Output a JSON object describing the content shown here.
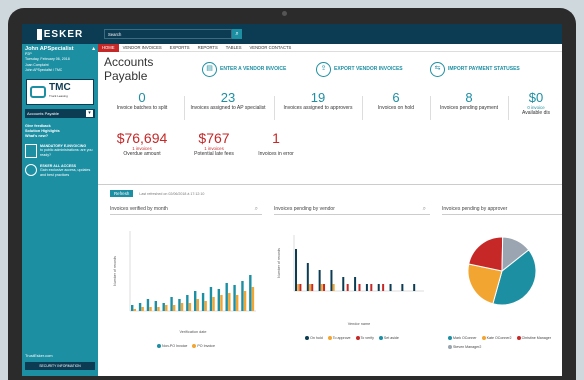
{
  "sidebar": {
    "logo": "ESKER",
    "user_name": "John APSpecialist",
    "user_lines": [
      "P2P",
      "Tuesday, February 06, 2018"
    ],
    "user_sub": [
      "Joan Complaint",
      "John APSpecialist / TMC"
    ],
    "company_short": "TMC",
    "company_sub": "Truck Leasing",
    "select_value": "Accounts Payable",
    "links": [
      "Give feedback",
      "Solution Highlights",
      "What's new?"
    ],
    "promo1_title": "MANDATORY E-INVOICING",
    "promo1_body": "to public administrations: are you ready?",
    "promo2_title": "ESKER ALL ACCESS",
    "promo2_body": "Gain exclusive access, updates and best practices",
    "footer_link": "TrustEsker.com",
    "security_button": "SECURITY INFORMATION"
  },
  "top": {
    "search_value": "Search",
    "nav": [
      "HOME",
      "VENDOR INVOICES",
      "EXPORTS",
      "REPORTS",
      "TABLES",
      "VENDOR CONTACTS"
    ]
  },
  "header": {
    "title": "Accounts Payable",
    "actions": [
      "ENTER A VENDOR INVOICE",
      "EXPORT VENDOR INVOICES",
      "IMPORT PAYMENT STATUSES"
    ]
  },
  "kpis": [
    {
      "value": "0",
      "label": "Invoice batches to split"
    },
    {
      "value": "23",
      "label": "Invoices assigned to AP specialist"
    },
    {
      "value": "19",
      "label": "Invoices assigned to approvers"
    },
    {
      "value": "6",
      "label": "Invoices on hold"
    },
    {
      "value": "8",
      "label": "Invoices pending payment"
    },
    {
      "value": "$0",
      "sub": "0 invoice",
      "label": "Available dis"
    }
  ],
  "kpis2": [
    {
      "value": "$76,694",
      "sub": "1 invoices",
      "label": "Overdue amount"
    },
    {
      "value": "$767",
      "sub": "1 invoices",
      "label": "Potential late fees"
    },
    {
      "value": "1",
      "label": "Invoices in error"
    }
  ],
  "refresh": {
    "button": "Refresh",
    "text": "Last refreshed on 02/06/2018 à 17:12:10"
  },
  "panels": {
    "p1_title": "Invoices verified by month",
    "p2_title": "Invoices pending by vendor",
    "p3_title": "Invoices pending by approver",
    "p1_xlabel": "Verification date",
    "p1_ylabel": "Number of records",
    "p2_xlabel": "Vendor name",
    "p2_ylabel": "Number of records",
    "p1_legend": [
      "Non-PO Invoice",
      "PO Invoice"
    ],
    "p2_legend": [
      "On hold",
      "To approve",
      "To verify",
      "Set aside"
    ],
    "p3_legend": [
      "Mark OConner",
      "Kate OConner2",
      "Christine Manager",
      "Steven Manager2"
    ]
  },
  "colors": {
    "teal": "#1d8fa3",
    "navy": "#0c3c54",
    "red": "#c62828",
    "amber": "#f2a531",
    "grey": "#9aa5b1"
  },
  "chart_data": [
    {
      "type": "bar",
      "title": "Invoices verified by month",
      "xlabel": "Verification date",
      "ylabel": "Number of records",
      "ylim": [
        0,
        40
      ],
      "series": [
        {
          "name": "Non-PO Invoice",
          "values": [
            3,
            4,
            6,
            5,
            4,
            7,
            6,
            8,
            10,
            9,
            12,
            11,
            14,
            13,
            15,
            18
          ]
        },
        {
          "name": "PO Invoice",
          "values": [
            1,
            2,
            2,
            2,
            3,
            3,
            4,
            4,
            6,
            5,
            7,
            8,
            9,
            8,
            10,
            12
          ]
        }
      ]
    },
    {
      "type": "bar",
      "title": "Invoices pending by vendor",
      "xlabel": "Vendor name",
      "ylabel": "Number of records",
      "series": [
        {
          "name": "On hold",
          "values": [
            6,
            4,
            3,
            3,
            2,
            2,
            1,
            1,
            1,
            1,
            1
          ]
        },
        {
          "name": "To approve",
          "values": [
            1,
            1,
            1,
            1,
            0,
            0,
            0,
            0,
            0,
            0,
            0
          ]
        },
        {
          "name": "To verify",
          "values": [
            1,
            1,
            1,
            0,
            1,
            1,
            1,
            1,
            0,
            0,
            0
          ]
        },
        {
          "name": "Set aside",
          "values": [
            0,
            0,
            0,
            0,
            0,
            0,
            0,
            0,
            0,
            0,
            0
          ]
        }
      ]
    },
    {
      "type": "pie",
      "title": "Invoices pending by approver",
      "slices": [
        {
          "name": "Mark OConner",
          "value": 40
        },
        {
          "name": "Kate OConner2",
          "value": 24
        },
        {
          "name": "Christine Manager",
          "value": 22
        },
        {
          "name": "Steven Manager2",
          "value": 14
        }
      ]
    }
  ]
}
